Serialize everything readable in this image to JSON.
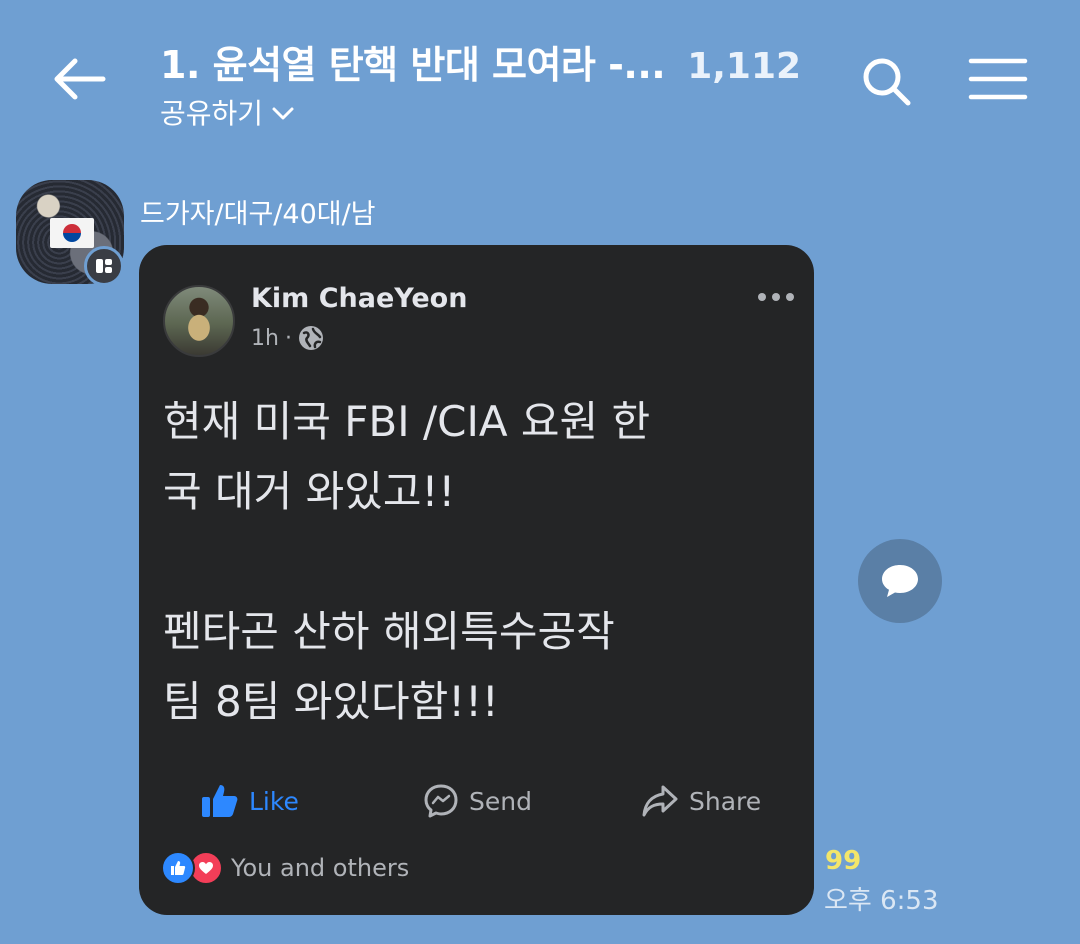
{
  "header": {
    "room_title": "1. 윤석열 탄핵 반대 모여라 -...",
    "member_count": "1,112",
    "share_label": "공유하기"
  },
  "message": {
    "sender_name": "드가자/대구/40대/남",
    "unread_count": "99",
    "time": "오후 6:53"
  },
  "post": {
    "author": "Kim ChaeYeon",
    "time_ago": "1h",
    "body": "현재 미국 FBI /CIA 요원 한\n국 대거 와있고!!\n\n펜타곤 산하 해외특수공작\n팀 8팀 와있다함!!!",
    "actions": {
      "like": "Like",
      "send": "Send",
      "share": "Share"
    },
    "reactions_text": "You and others"
  },
  "icons": {
    "back": "back-arrow-icon",
    "search": "search-icon",
    "menu": "hamburger-menu-icon",
    "chevron": "chevron-down-icon",
    "globe": "globe-icon",
    "more": "more-horizontal-icon",
    "like": "thumbs-up-icon",
    "send": "messenger-icon",
    "share": "share-arrow-icon",
    "comment": "speech-bubble-icon"
  },
  "colors": {
    "chat_background": "#6f9fd2",
    "card_background": "#242526",
    "facebook_blue": "#2d88ff",
    "love_red": "#f33e58",
    "unread_yellow": "#f3e66a"
  }
}
